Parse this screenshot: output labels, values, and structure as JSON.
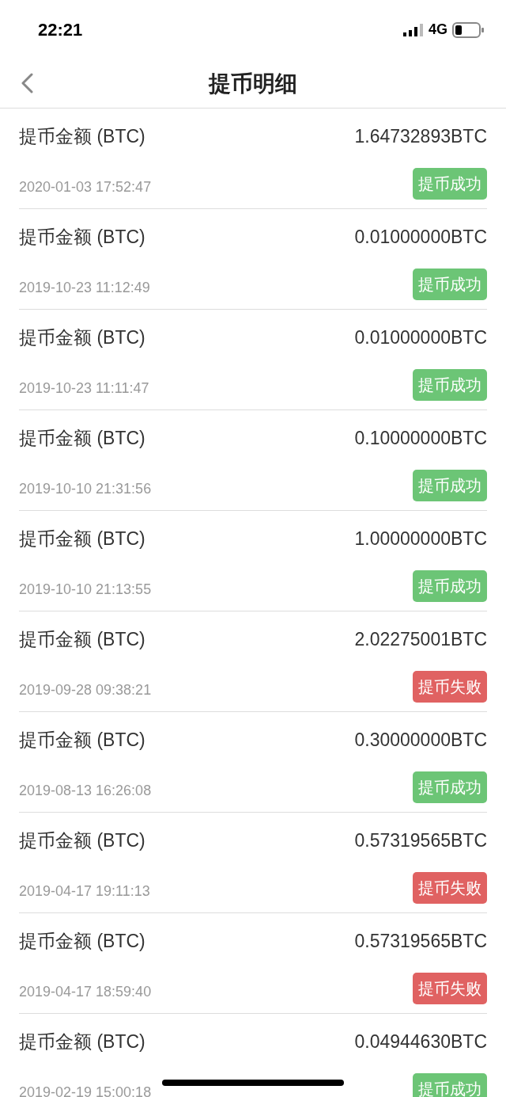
{
  "status_bar": {
    "time": "22:21",
    "network": "4G"
  },
  "header": {
    "title": "提币明细"
  },
  "records": [
    {
      "label": "提币金额 (BTC)",
      "amount": "1.64732893BTC",
      "time": "2020-01-03 17:52:47",
      "status": {
        "kind": "success",
        "text": "提币成功"
      }
    },
    {
      "label": "提币金额 (BTC)",
      "amount": "0.01000000BTC",
      "time": "2019-10-23 11:12:49",
      "status": {
        "kind": "success",
        "text": "提币成功"
      }
    },
    {
      "label": "提币金额 (BTC)",
      "amount": "0.01000000BTC",
      "time": "2019-10-23 11:11:47",
      "status": {
        "kind": "success",
        "text": "提币成功"
      }
    },
    {
      "label": "提币金额 (BTC)",
      "amount": "0.10000000BTC",
      "time": "2019-10-10 21:31:56",
      "status": {
        "kind": "success",
        "text": "提币成功"
      }
    },
    {
      "label": "提币金额 (BTC)",
      "amount": "1.00000000BTC",
      "time": "2019-10-10 21:13:55",
      "status": {
        "kind": "success",
        "text": "提币成功"
      }
    },
    {
      "label": "提币金额 (BTC)",
      "amount": "2.02275001BTC",
      "time": "2019-09-28 09:38:21",
      "status": {
        "kind": "fail",
        "text": "提币失败"
      }
    },
    {
      "label": "提币金额 (BTC)",
      "amount": "0.30000000BTC",
      "time": "2019-08-13 16:26:08",
      "status": {
        "kind": "success",
        "text": "提币成功"
      }
    },
    {
      "label": "提币金额 (BTC)",
      "amount": "0.57319565BTC",
      "time": "2019-04-17 19:11:13",
      "status": {
        "kind": "fail",
        "text": "提币失败"
      }
    },
    {
      "label": "提币金额 (BTC)",
      "amount": "0.57319565BTC",
      "time": "2019-04-17 18:59:40",
      "status": {
        "kind": "fail",
        "text": "提币失败"
      }
    },
    {
      "label": "提币金额 (BTC)",
      "amount": "0.04944630BTC",
      "time": "2019-02-19 15:00:18",
      "status": {
        "kind": "success",
        "text": "提币成功"
      }
    }
  ]
}
